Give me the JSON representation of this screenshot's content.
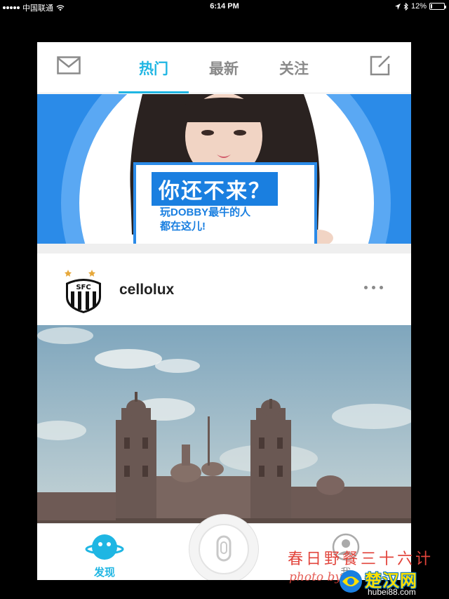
{
  "status_bar": {
    "carrier": "中国联通",
    "time": "6:14 PM",
    "battery_text": "12%",
    "battery_level": 0.12
  },
  "header": {
    "tabs": [
      {
        "label": "热门",
        "active": true
      },
      {
        "label": "最新",
        "active": false
      },
      {
        "label": "关注",
        "active": false
      }
    ],
    "icons": {
      "left": "mail-icon",
      "right": "compose-icon"
    }
  },
  "banner": {
    "headline": "你还不来？",
    "line1": "玩DOBBY最牛的人",
    "line2": "都在这儿!",
    "page_count": 2,
    "current_page": 1,
    "colors": {
      "primary": "#2b8be8",
      "ring": "#5aa8f3"
    }
  },
  "post": {
    "username": "cellolux",
    "avatar": "club-crest-avatar"
  },
  "tab_bar": {
    "discover_label": "发现",
    "me_label": "我",
    "center_icon": "camera-capture-icon",
    "accent": "#1fb6e3"
  },
  "watermark": {
    "line1": "春日野餐三十六计",
    "line2": "photo by",
    "site_name": "楚汉网",
    "site_url": "hubei88.com"
  }
}
